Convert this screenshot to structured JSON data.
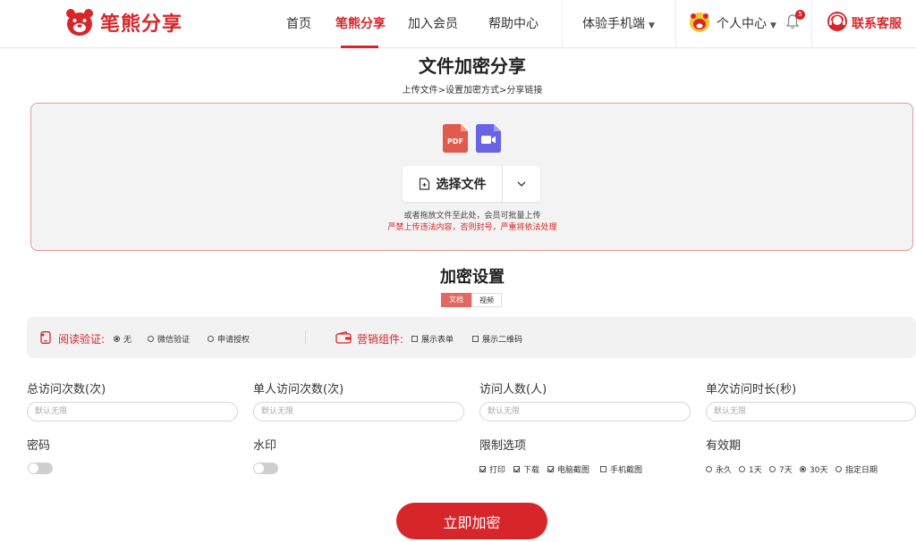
{
  "brand": {
    "name": "笔熊分享",
    "color": "#d7262a"
  },
  "nav": {
    "home": "首页",
    "share": "笔熊分享",
    "join": "加入会员",
    "help": "帮助中心",
    "mobile": "体验手机端",
    "personal": "个人中心",
    "notification_count": "5",
    "support": "联系客服"
  },
  "page": {
    "title": "文件加密分享",
    "steps": "上传文件>设置加密方式>分享链接"
  },
  "upload": {
    "file_type_icons": [
      "pdf-icon",
      "video-icon"
    ],
    "pdf_label": "PDF",
    "choose_label": "选择文件",
    "hint": "或者拖放文件至此处，会员可批量上传",
    "warning": "严禁上传违法内容，否则封号，严重将依法处理"
  },
  "encrypt": {
    "title": "加密设置",
    "tabs": [
      "文档",
      "视频"
    ],
    "verify": {
      "label": "阅读验证:",
      "options": [
        {
          "label": "无",
          "selected": true
        },
        {
          "label": "微信验证",
          "selected": false
        },
        {
          "label": "申请授权",
          "selected": false
        }
      ]
    },
    "marketing": {
      "label": "营销组件:",
      "options": [
        {
          "label": "展示表单",
          "checked": false
        },
        {
          "label": "展示二维码",
          "checked": false
        }
      ]
    }
  },
  "fields": {
    "total_visits": {
      "label": "总访问次数(次)",
      "placeholder": "默认无限"
    },
    "per_user_visits": {
      "label": "单人访问次数(次)",
      "placeholder": "默认无限"
    },
    "visitors": {
      "label": "访问人数(人)",
      "placeholder": "默认无限"
    },
    "duration": {
      "label": "单次访问时长(秒)",
      "placeholder": "默认无限"
    },
    "password": {
      "label": "密码",
      "enabled": false
    },
    "watermark": {
      "label": "水印",
      "enabled": false
    },
    "restrictions": {
      "label": "限制选项",
      "options": [
        {
          "label": "打印",
          "checked": true
        },
        {
          "label": "下载",
          "checked": true
        },
        {
          "label": "电脑截图",
          "checked": true
        },
        {
          "label": "手机截图",
          "checked": false
        }
      ]
    },
    "validity": {
      "label": "有效期",
      "options": [
        {
          "label": "永久",
          "selected": false
        },
        {
          "label": "1天",
          "selected": false
        },
        {
          "label": "7天",
          "selected": false
        },
        {
          "label": "30天",
          "selected": true
        },
        {
          "label": "指定日期",
          "selected": false
        }
      ]
    }
  },
  "submit_label": "立即加密"
}
